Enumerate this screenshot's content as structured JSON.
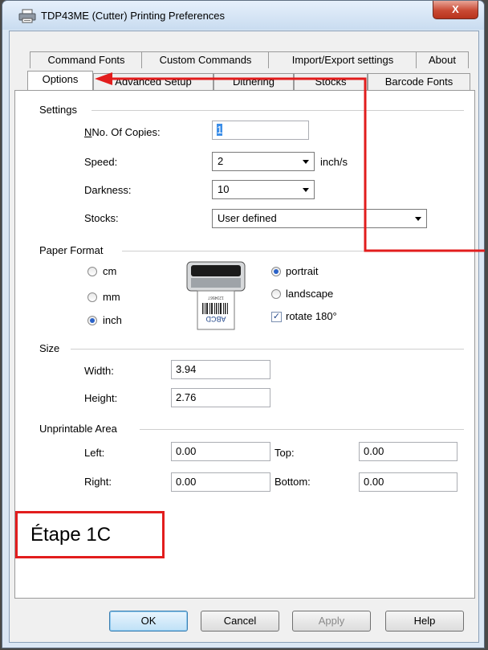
{
  "window": {
    "title": "TDP43ME (Cutter) Printing Preferences",
    "close_label": "X"
  },
  "tabs": {
    "row_back": [
      "Command Fonts",
      "Custom Commands",
      "Import/Export settings",
      "About"
    ],
    "row_front": [
      "Options",
      "Advanced Setup",
      "Dithering",
      "Stocks",
      "Barcode Fonts"
    ],
    "active": "Options"
  },
  "settings": {
    "group_title": "Settings",
    "copies_label": "No. Of Copies:",
    "copies_value": "1",
    "speed_label": "Speed:",
    "speed_value": "2",
    "speed_unit": "inch/s",
    "darkness_label": "Darkness:",
    "darkness_value": "10",
    "stocks_label": "Stocks:",
    "stocks_value": "User defined"
  },
  "paper_format": {
    "group_title": "Paper Format",
    "units": [
      "cm",
      "mm",
      "inch"
    ],
    "selected_unit": "inch",
    "orientation": [
      "portrait",
      "landscape"
    ],
    "selected_orientation": "portrait",
    "rotate_label": "rotate 180°",
    "rotate_checked": true,
    "label_preview_text": "ABCD",
    "label_preview_code": "1234567"
  },
  "size": {
    "group_title": "Size",
    "width_label": "Width:",
    "width_value": "3.94",
    "height_label": "Height:",
    "height_value": "2.76"
  },
  "unprintable": {
    "group_title": "Unprintable Area",
    "left_label": "Left:",
    "left_value": "0.00",
    "top_label": "Top:",
    "top_value": "0.00",
    "right_label": "Right:",
    "right_value": "0.00",
    "bottom_label": "Bottom:",
    "bottom_value": "0.00"
  },
  "buttons": {
    "ok": "OK",
    "cancel": "Cancel",
    "apply": "Apply",
    "help": "Help"
  },
  "annotation": {
    "text": "Étape 1C",
    "color": "#e21d1d"
  }
}
